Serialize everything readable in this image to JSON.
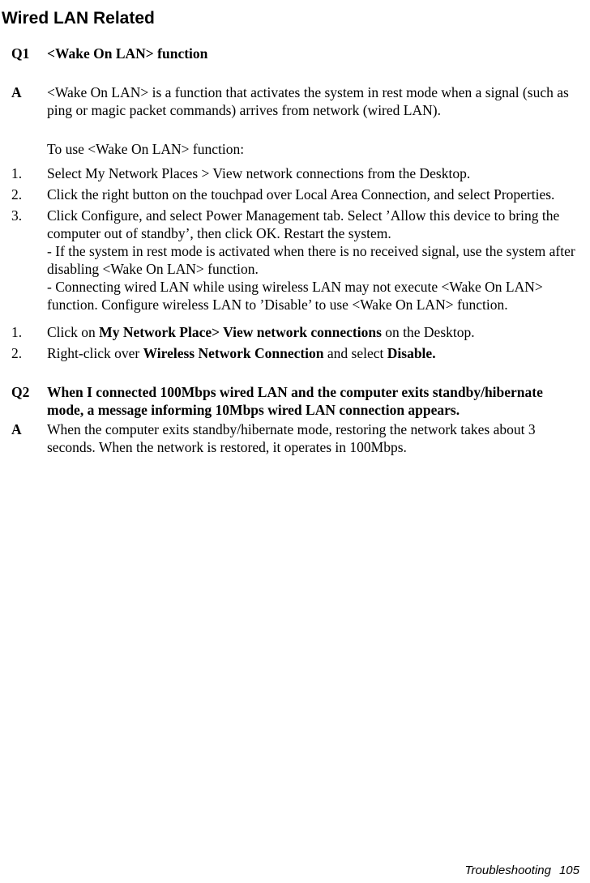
{
  "page": {
    "section_title": "Wired LAN Related",
    "footer": {
      "label": "Troubleshooting",
      "page_number": "105"
    }
  },
  "faq": [
    {
      "marker": "Q1",
      "question": "<Wake On LAN> function"
    },
    {
      "marker": "A",
      "answer": "<Wake On LAN> is a function that activates the system in rest mode when a signal (such as ping or magic packet commands) arrives from network (wired LAN)."
    }
  ],
  "intro_line": "To use <Wake On LAN> function:",
  "steps_primary": [
    {
      "marker": "1.",
      "text": "Select My Network Places > View network connections from the Desktop."
    },
    {
      "marker": "2.",
      "text": "Click the right button on the touchpad over Local Area Connection, and select Properties."
    },
    {
      "marker": "3.",
      "text": "Click Configure, and select Power Management tab. Select ’Allow this device to bring the computer out of standby’, then click OK. Restart the system.",
      "notes": [
        "- If the system in rest mode is activated when there is no received signal, use the system after disabling <Wake On LAN> function.",
        "- Connecting wired LAN while using wireless LAN may not execute <Wake On LAN> function. Configure wireless LAN to ’Disable’ to use <Wake On LAN> function."
      ]
    }
  ],
  "steps_secondary": [
    {
      "marker": "1.",
      "prefix": "Click on ",
      "bold1": "My Network Place> View network connections",
      "middle": " on the Desktop.",
      "bold2": "",
      "suffix": ""
    },
    {
      "marker": "2.",
      "prefix": "Right-click over ",
      "bold1": "Wireless Network Connection",
      "middle": " and select ",
      "bold2": "Disable.",
      "suffix": ""
    }
  ],
  "faq2": [
    {
      "marker": "Q2",
      "question": "When I connected 100Mbps wired LAN and the computer exits standby/hibernate mode, a message informing 10Mbps wired LAN connection appears."
    },
    {
      "marker": "A",
      "answer": "When the computer exits standby/hibernate mode, restoring the network takes about 3 seconds. When the network is restored, it operates in 100Mbps."
    }
  ]
}
